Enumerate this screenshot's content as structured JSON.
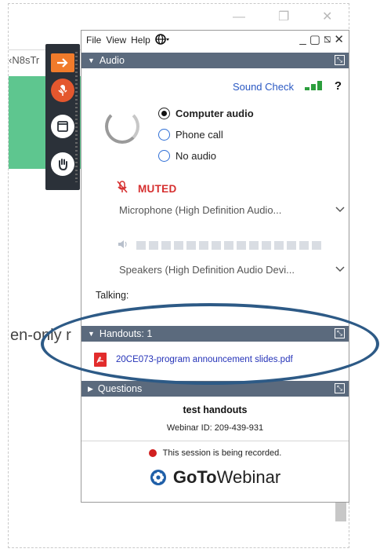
{
  "background_window": {
    "left_text_top": "‹N8sTr",
    "left_text_mid": "en-only r"
  },
  "dock": {
    "icons": [
      "arrow-right-icon",
      "microphone-icon",
      "screen-icon",
      "raise-hand-icon"
    ]
  },
  "menu": {
    "file": "File",
    "view": "View",
    "help": "Help"
  },
  "audio": {
    "header": "Audio",
    "sound_check": "Sound Check",
    "help": "?",
    "options": [
      {
        "label": "Computer audio",
        "selected": true
      },
      {
        "label": "Phone call",
        "selected": false
      },
      {
        "label": "No audio",
        "selected": false
      }
    ],
    "muted": "MUTED",
    "microphone": "Microphone (High Definition Audio...",
    "speakers": "Speakers (High Definition Audio Devi...",
    "talking": "Talking:"
  },
  "handouts": {
    "header": "Handouts: 1",
    "file": "20CE073-program announcement slides.pdf"
  },
  "questions": {
    "header": "Questions",
    "title": "test handouts",
    "webinar_id": "Webinar ID: 209-439-931",
    "recording": "This session is being recorded.",
    "brand_bold": "GoTo",
    "brand_regular": "Webinar"
  },
  "colors": {
    "section_header": "#5b6a7d",
    "muted": "#d62f2f",
    "link": "#2432b8",
    "signal": "#2c9e3d",
    "highlight": "#2d5a86"
  }
}
